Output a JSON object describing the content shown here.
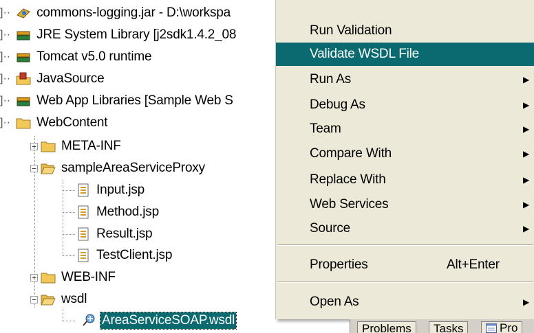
{
  "tree": {
    "items": [
      {
        "label": "commons-logging.jar - D:\\workspa",
        "icon": "jar-icon"
      },
      {
        "label": "JRE System Library [j2sdk1.4.2_08",
        "icon": "library-icon"
      },
      {
        "label": "Tomcat v5.0 runtime",
        "icon": "library-icon"
      },
      {
        "label": "JavaSource",
        "icon": "source-folder-icon"
      },
      {
        "label": "Web App Libraries [Sample Web S",
        "icon": "library-icon"
      },
      {
        "label": "WebContent",
        "icon": "folder-icon"
      },
      {
        "label": "META-INF",
        "icon": "folder-icon"
      },
      {
        "label": "sampleAreaServiceProxy",
        "icon": "folder-icon"
      },
      {
        "label": "Input.jsp",
        "icon": "jsp-file-icon"
      },
      {
        "label": "Method.jsp",
        "icon": "jsp-file-icon"
      },
      {
        "label": "Result.jsp",
        "icon": "jsp-file-icon"
      },
      {
        "label": "TestClient.jsp",
        "icon": "jsp-file-icon"
      },
      {
        "label": "WEB-INF",
        "icon": "folder-icon"
      },
      {
        "label": "wsdl",
        "icon": "folder-icon"
      },
      {
        "label": "AreaServiceSOAP.wsdl",
        "icon": "wsdl-file-icon"
      }
    ]
  },
  "menu": {
    "items": [
      {
        "label": "Run Validation"
      },
      {
        "label": "Validate WSDL File"
      },
      {
        "label": "Run As"
      },
      {
        "label": "Debug As"
      },
      {
        "label": "Team"
      },
      {
        "label": "Compare With"
      },
      {
        "label": "Replace With"
      },
      {
        "label": "Web Services"
      },
      {
        "label": "Source"
      },
      {
        "label": "Properties",
        "accelerator": "Alt+Enter"
      },
      {
        "label": "Open As"
      }
    ]
  },
  "tabs": [
    "Problems",
    "Tasks",
    "Pro"
  ],
  "colors": {
    "highlight": "#0b6a6f",
    "menu_bg": "#ece9d8"
  }
}
